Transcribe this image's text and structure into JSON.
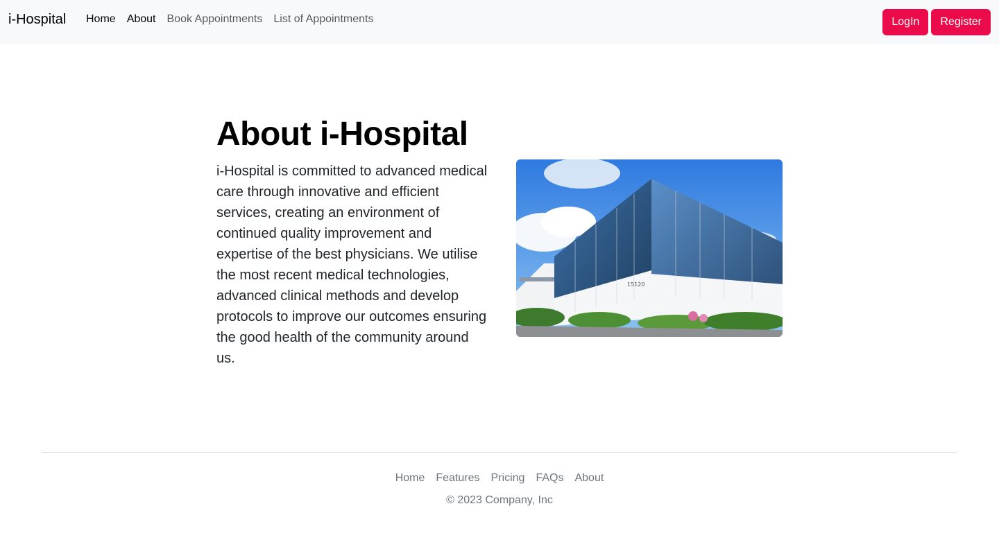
{
  "navbar": {
    "brand": "i-Hospital",
    "links": [
      {
        "label": "Home"
      },
      {
        "label": "About"
      },
      {
        "label": "Book Appointments"
      },
      {
        "label": "List of Appointments"
      }
    ],
    "login_label": "LogIn",
    "register_label": "Register",
    "accent_color": "#eb0a4a"
  },
  "main": {
    "title": "About i-Hospital",
    "paragraph": "i-Hospital is committed to advanced medical care through innovative and efficient services, creating an environment of continued quality improvement and expertise of the best physicians. We utilise the most recent medical technologies, advanced clinical methods and develop protocols to improve our outcomes ensuring the good health of the community around us.",
    "image": {
      "subject": "hospital-building-photo",
      "building_number": "15120"
    }
  },
  "footer": {
    "links": [
      {
        "label": "Home"
      },
      {
        "label": "Features"
      },
      {
        "label": "Pricing"
      },
      {
        "label": "FAQs"
      },
      {
        "label": "About"
      }
    ],
    "copyright": "© 2023 Company, Inc"
  }
}
